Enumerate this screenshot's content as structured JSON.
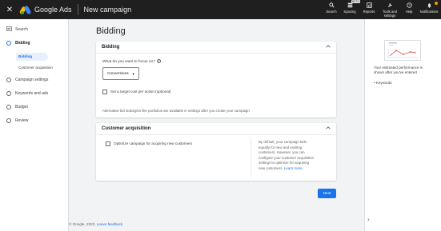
{
  "topbar": {
    "close_icon": "close-icon",
    "brand": "Google Ads",
    "title": "New campaign",
    "actions": [
      {
        "name": "search",
        "icon": "search-icon",
        "label": "Search"
      },
      {
        "name": "spacing",
        "icon": "spacing-icon",
        "label": "Spacing",
        "badge": "BETA"
      },
      {
        "name": "reports",
        "icon": "reports-icon",
        "label": "Reports"
      },
      {
        "name": "tools",
        "icon": "wrench-icon",
        "label_line1": "Tools and",
        "label_line2": "settings"
      },
      {
        "name": "help",
        "icon": "help-icon",
        "label": "Help"
      },
      {
        "name": "notifications",
        "icon": "bell-icon",
        "label": "Notifications"
      }
    ]
  },
  "leftnav": {
    "search_label": "Search",
    "bidding_label": "Bidding",
    "sub_bidding": "Bidding",
    "sub_customer": "Customer acquisition",
    "campaign_settings": "Campaign settings",
    "keywords_ads": "Keywords and ads",
    "budget": "Budget",
    "review": "Review"
  },
  "main": {
    "page_title": "Bidding",
    "bidding_card": {
      "title": "Bidding",
      "question": "What do you want to focus on?",
      "select_value": "Conversions",
      "checkbox_label": "Set a target cost per action (optional)",
      "hint": "Alternative bid strategies like portfolios are available in settings after you create your campaign"
    },
    "customer_card": {
      "title": "Customer acquisition",
      "checkbox_label": "Optimize campaign for acquiring new customers",
      "desc_line1": "By default, your campaign bids",
      "desc_line2": "equally for new and existing",
      "desc_line3": "customers. However, you can",
      "desc_line4": "configure your customer acquisition",
      "desc_line5": "settings to optimize for acquiring",
      "desc_line6": "new customers.",
      "learn_more": "Learn more"
    },
    "next_label": "Next"
  },
  "footer": {
    "copyright": "© Google, 2023.",
    "feedback": "Leave feedback"
  },
  "rightpanel": {
    "perf_line1": "Your estimated performance is",
    "perf_line2": "shown after you've entered",
    "bullet": "Keywords"
  },
  "colors": {
    "accent": "#1a73e8",
    "topbar_bg": "#1f1f1f",
    "page_bg": "#f1f3f4",
    "chart_line": "#e06666"
  }
}
